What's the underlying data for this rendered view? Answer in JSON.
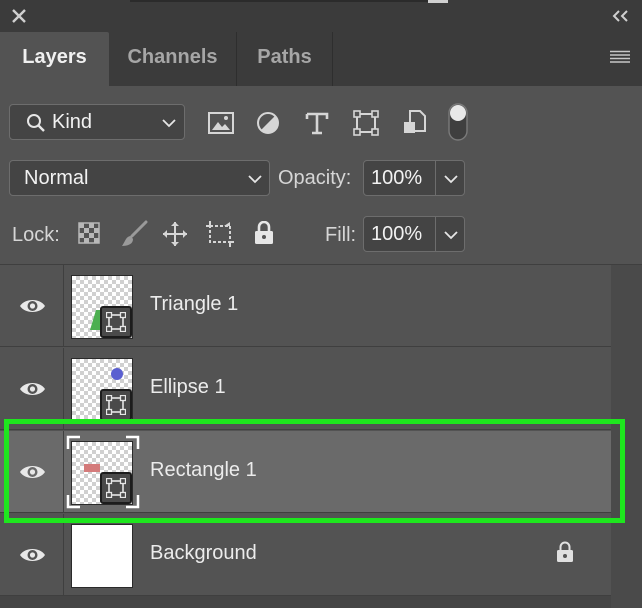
{
  "tabs": [
    {
      "label": "Layers",
      "active": true
    },
    {
      "label": "Channels",
      "active": false
    },
    {
      "label": "Paths",
      "active": false
    }
  ],
  "filter": {
    "kind_label": "Kind",
    "icons": [
      "image-filter-icon",
      "adjustment-filter-icon",
      "type-filter-icon",
      "shape-filter-icon",
      "smart-object-filter-icon",
      "filter-toggle-icon"
    ]
  },
  "blend": {
    "mode": "Normal",
    "opacity_label": "Opacity:",
    "opacity_value": "100%"
  },
  "lock": {
    "label": "Lock:",
    "fill_label": "Fill:",
    "fill_value": "100%"
  },
  "layers": [
    {
      "name": "Triangle 1",
      "visible": true,
      "type": "shape",
      "swatch": "#4caf50"
    },
    {
      "name": "Ellipse 1",
      "visible": true,
      "type": "shape",
      "swatch": "#5a5fd0"
    },
    {
      "name": "Rectangle 1",
      "visible": true,
      "type": "shape",
      "swatch": "#d47b7b",
      "selected": true
    },
    {
      "name": "Background",
      "visible": true,
      "type": "background",
      "locked": true
    }
  ],
  "colors": {
    "panel": "#535353",
    "selected_row": "#6a6a6a",
    "highlight": "#1ee61e"
  }
}
